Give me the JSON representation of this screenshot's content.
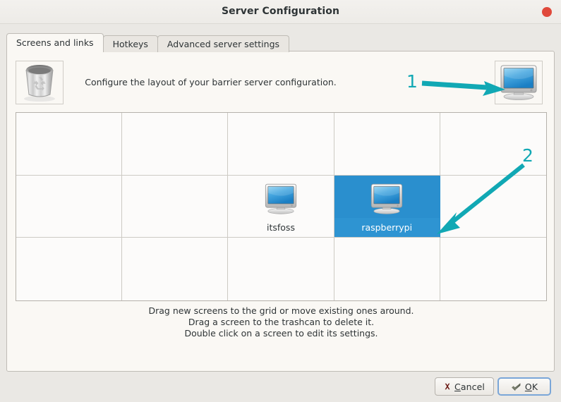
{
  "window": {
    "title": "Server Configuration",
    "close_icon": "close-dot-icon",
    "close_color": "#e0493b"
  },
  "tabs": [
    {
      "label": "Screens and links",
      "active": true
    },
    {
      "label": "Hotkeys",
      "active": false
    },
    {
      "label": "Advanced server settings",
      "active": false
    }
  ],
  "header": {
    "instruction": "Configure the layout of your barrier server configuration.",
    "trash_icon": "trashcan-icon",
    "new_screen_icon": "monitor-icon"
  },
  "grid": {
    "columns": 5,
    "rows": 3,
    "screens": [
      {
        "name": "itsfoss",
        "row": 2,
        "col": 3,
        "selected": false
      },
      {
        "name": "raspberrypi",
        "row": 2,
        "col": 4,
        "selected": true
      }
    ],
    "selection_color": "#2a8fce"
  },
  "instructions": {
    "line1": "Drag new screens to the grid or move existing ones around.",
    "line2": "Drag a screen to the trashcan to delete it.",
    "line3": "Double click on a screen to edit its settings."
  },
  "buttons": {
    "cancel": {
      "label": "Cancel",
      "icon": "cancel-x-icon",
      "icon_color": "#6b1a15"
    },
    "ok": {
      "label": "OK",
      "icon": "apply-check-icon",
      "icon_color": "#555a4e",
      "focused": true
    }
  },
  "annotations": [
    {
      "number": "1",
      "color": "#11a8b4",
      "points_to": "new-screen-monitor-icon"
    },
    {
      "number": "2",
      "color": "#11a8b4",
      "points_to": "selected-screen-raspberrypi"
    }
  ]
}
